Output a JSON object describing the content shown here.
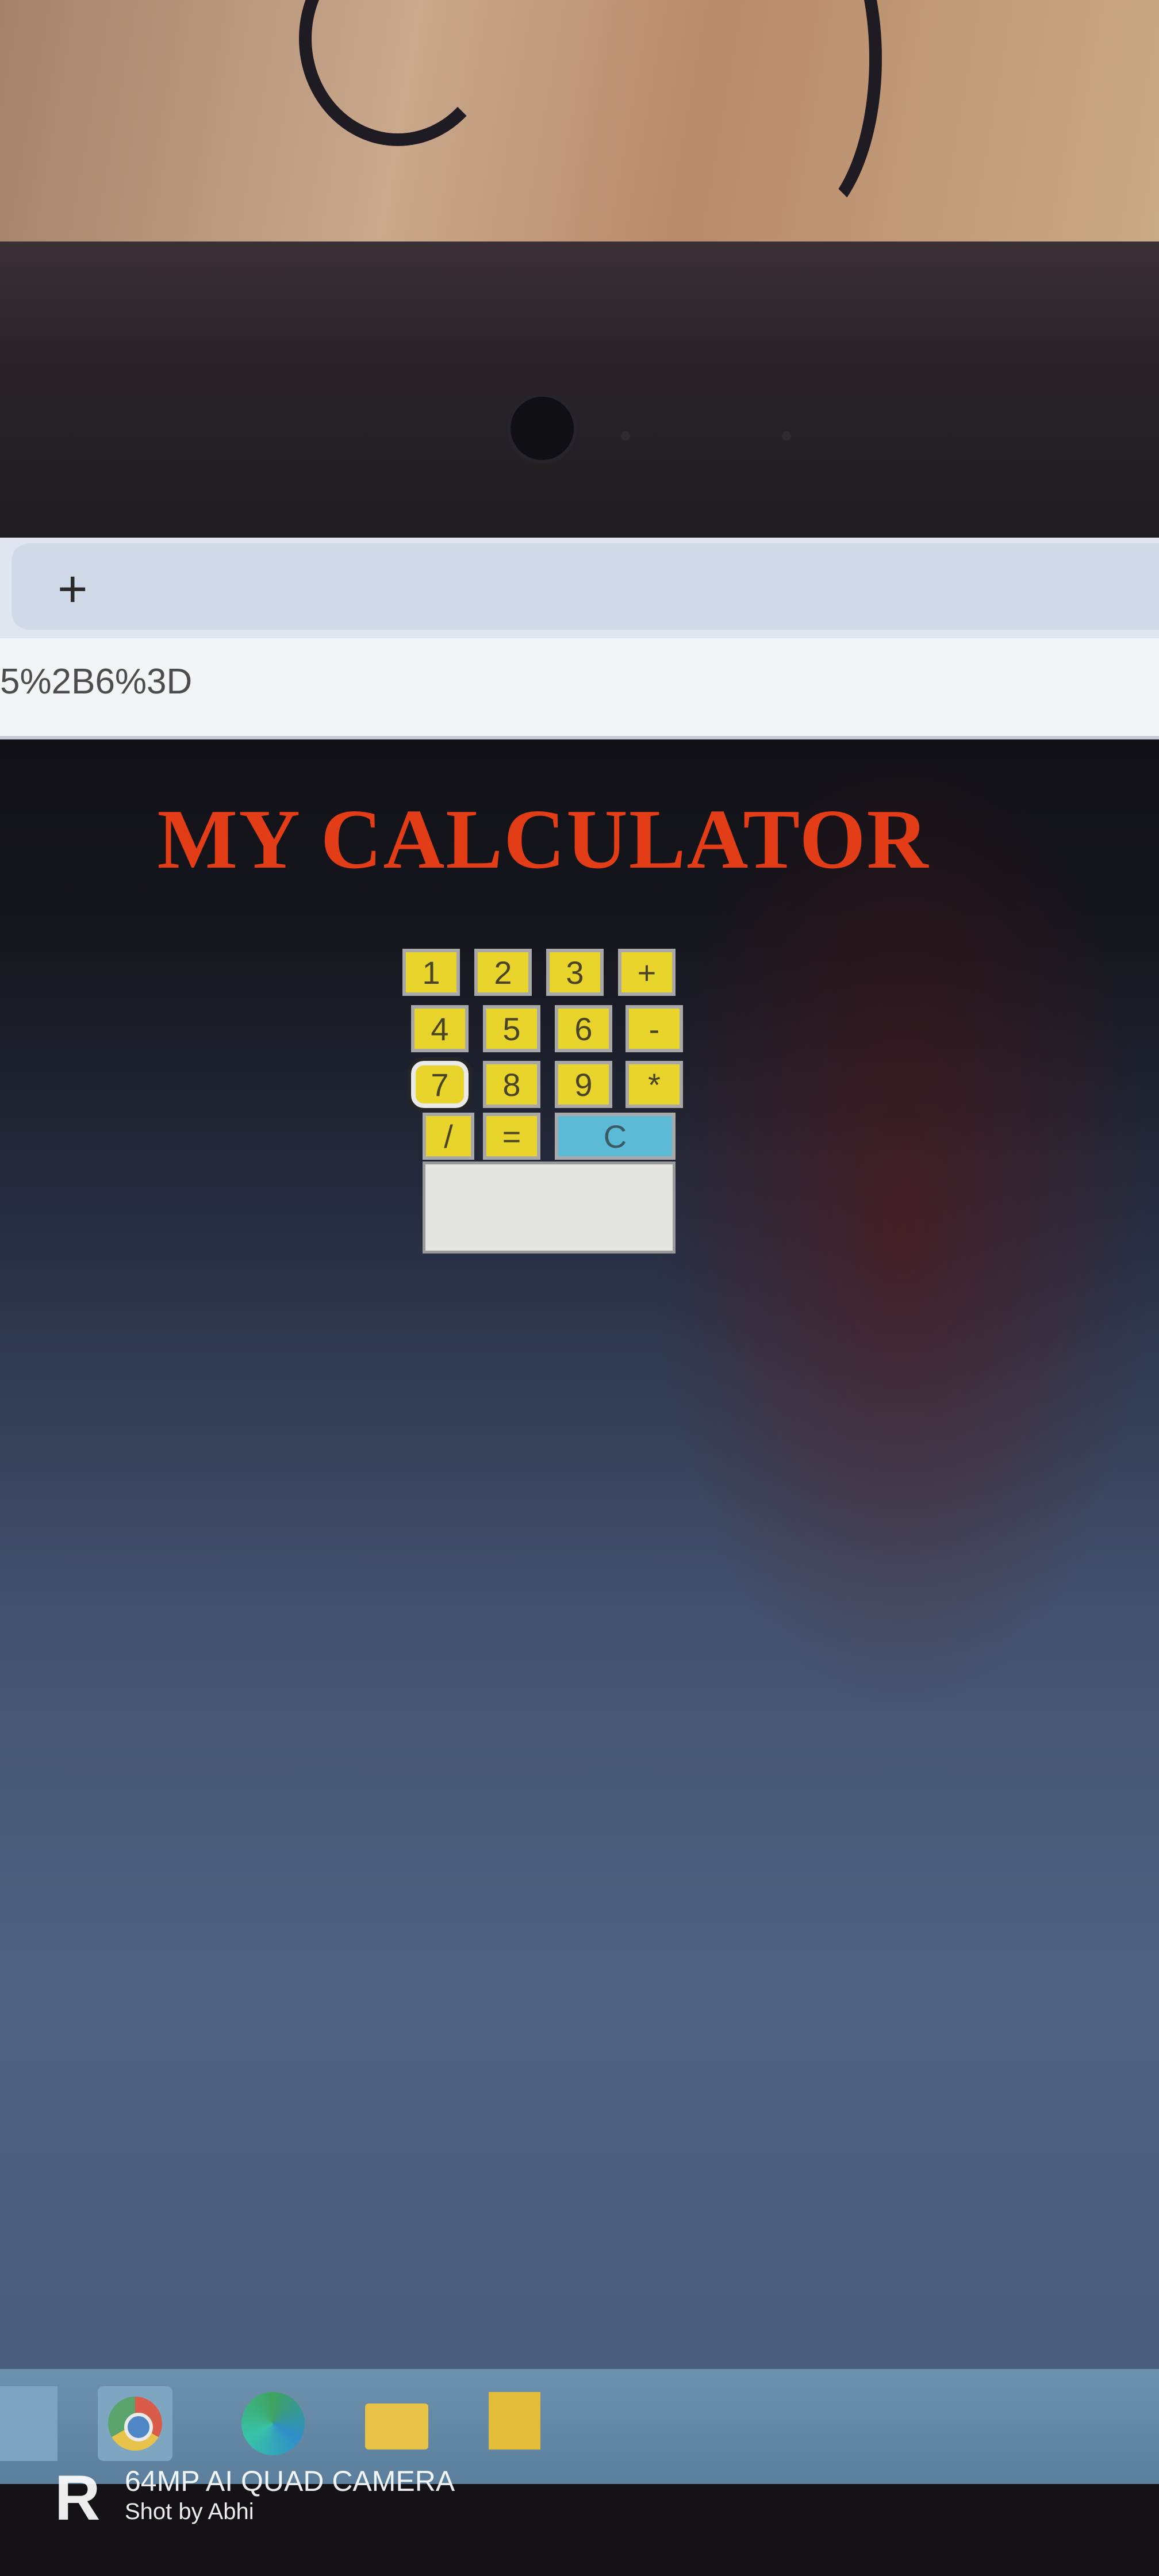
{
  "browser": {
    "new_tab_label": "+",
    "url_text": "5%2B6%3D"
  },
  "page": {
    "title": "MY CALCULATOR",
    "keys": [
      {
        "label": "1",
        "name": "key-1"
      },
      {
        "label": "2",
        "name": "key-2"
      },
      {
        "label": "3",
        "name": "key-3"
      },
      {
        "label": "+",
        "name": "key-plus"
      },
      {
        "label": "4",
        "name": "key-4"
      },
      {
        "label": "5",
        "name": "key-5"
      },
      {
        "label": "6",
        "name": "key-6"
      },
      {
        "label": "-",
        "name": "key-minus"
      },
      {
        "label": "7",
        "name": "key-7"
      },
      {
        "label": "8",
        "name": "key-8"
      },
      {
        "label": "9",
        "name": "key-9"
      },
      {
        "label": "*",
        "name": "key-multiply"
      },
      {
        "label": "/",
        "name": "key-divide"
      },
      {
        "label": "=",
        "name": "key-equals"
      },
      {
        "label": "C",
        "name": "key-clear"
      }
    ],
    "display_value": ""
  },
  "colors": {
    "title": "#e23d16",
    "key": "#e9d42b",
    "clear_key": "#5bbad6"
  },
  "taskbar": {
    "icons": [
      "task-view-icon",
      "chrome-icon",
      "edge-icon",
      "file-explorer-icon",
      "sticky-notes-icon"
    ]
  },
  "watermark": {
    "logo": "R",
    "line1": "64MP AI QUAD CAMERA",
    "line2": "Shot by Abhi"
  }
}
